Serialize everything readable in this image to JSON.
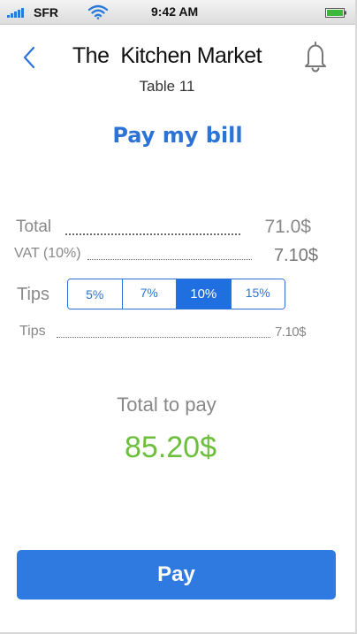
{
  "status_bar": {
    "carrier": "SFR",
    "time": "9:42 AM",
    "signal_icon": "signal-bars-icon",
    "wifi_icon": "wifi-icon",
    "battery_icon": "battery-icon"
  },
  "header": {
    "back_icon": "chevron-left-icon",
    "title": "The  Kitchen Market",
    "subtitle": "Table 11",
    "notification_icon": "bell-icon"
  },
  "page_title": "Pay my bill",
  "bill": {
    "total_label": "Total",
    "total_value": "71.0$",
    "vat_label": "VAT (10%)",
    "vat_value": "7.10$",
    "tips_label": "Tips",
    "tip_options": [
      "5%",
      "7%",
      "10%",
      "15%"
    ],
    "tip_selected": "10%",
    "tips_line_label": "Tips",
    "tips_line_value": "7.10$"
  },
  "summary": {
    "total_label": "Total to pay",
    "total_amount": "85.20$"
  },
  "pay_button_label": "Pay",
  "colors": {
    "accent": "#2b73d6",
    "pay_button": "#2e7ae0",
    "total_amount": "#6cbf3c",
    "muted_text": "#888888"
  }
}
